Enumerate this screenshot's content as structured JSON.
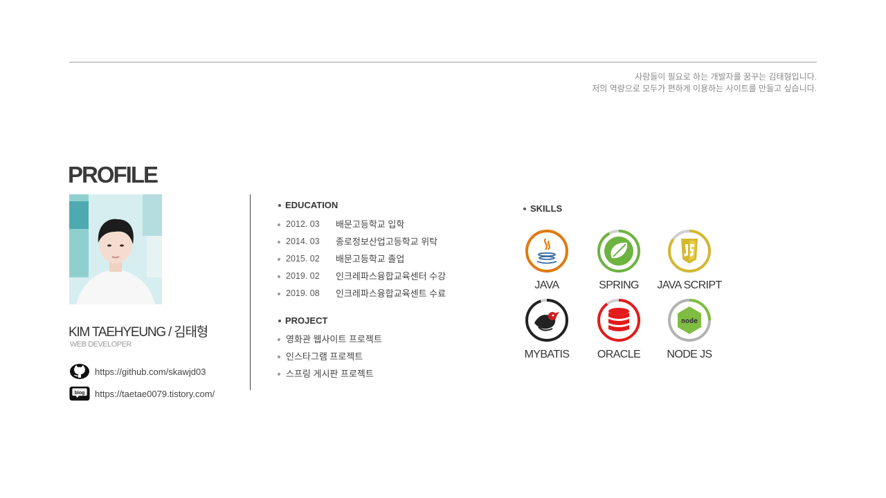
{
  "header": {
    "tagline_line1": "사람들이 필요로 하는 개발자를 꿈꾸는 김태형입니다.",
    "tagline_line2": "저의 역량으로 모두가 편하게 이용하는 사이트를 만들고 싶습니다."
  },
  "profile": {
    "title": "PROFILE",
    "name": "KIM TAEHYEUNG / 김태형",
    "role": "WEB DEVELOPER",
    "links": [
      {
        "icon": "github-icon",
        "url": "https://github.com/skawjd03"
      },
      {
        "icon": "blog-icon",
        "label": "blog",
        "url": "https://taetae0079.tistory.com/"
      }
    ]
  },
  "education": {
    "title": "EDUCATION",
    "items": [
      {
        "date": "2012. 03",
        "text": "배문고등학교 입학"
      },
      {
        "date": "2014. 03",
        "text": "종로정보산업고등학교 위탁"
      },
      {
        "date": "2015. 02",
        "text": "배문고등학교 졸업"
      },
      {
        "date": "2019. 02",
        "text": "인크레파스융합교육센터 수강"
      },
      {
        "date": "2019. 08",
        "text": "인크레파스융합교육센트 수료"
      }
    ]
  },
  "project": {
    "title": "PROJECT",
    "items": [
      "영화관 웹사이트 프로젝트",
      "인스타그램 프로젝트",
      "스프링 게시판 프로젝트"
    ]
  },
  "skills": {
    "title": "SKILLS",
    "items": [
      {
        "name": "JAVA",
        "icon": "java-icon",
        "color": "#e07a10",
        "level": 1.0
      },
      {
        "name": "SPRING",
        "icon": "spring-icon",
        "color": "#6db33f",
        "level": 0.92
      },
      {
        "name": "JAVA SCRIPT",
        "icon": "javascript-icon",
        "color": "#d4b830",
        "level": 0.85
      },
      {
        "name": "MYBATIS",
        "icon": "mybatis-icon",
        "color": "#222222",
        "level": 0.95
      },
      {
        "name": "ORACLE",
        "icon": "oracle-icon",
        "color": "#e31b1b",
        "level": 0.9
      },
      {
        "name": "NODE JS",
        "icon": "nodejs-icon",
        "color": "#7fbd42",
        "level": 0.25
      }
    ]
  }
}
